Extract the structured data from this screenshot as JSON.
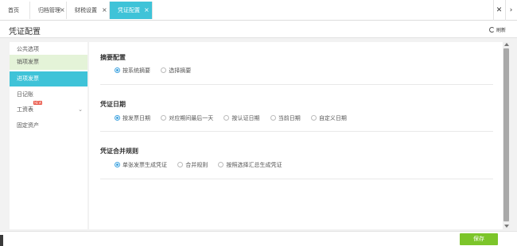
{
  "tabs": [
    {
      "label": "首页",
      "closable": false
    },
    {
      "label": "归档管理",
      "closable": true
    },
    {
      "label": "财税设置",
      "closable": true
    },
    {
      "label": "凭证配置",
      "closable": true,
      "active": true
    }
  ],
  "tabbar": {
    "close_glyph": "×",
    "close_all_glyph": "✕",
    "more_glyph": "›"
  },
  "header": {
    "title": "凭证配置",
    "refresh_label": "刷新"
  },
  "sidebar": {
    "items": [
      {
        "label": "公共选项"
      },
      {
        "label": "销项发票",
        "state": "light"
      },
      {
        "label": "进项发票",
        "state": "active"
      },
      {
        "label": "日记账"
      },
      {
        "label": "工资表",
        "badge": "NEW",
        "has_children": true
      },
      {
        "label": "固定资产"
      }
    ]
  },
  "sections": [
    {
      "title": "摘要配置",
      "options": [
        {
          "label": "按系统摘要",
          "checked": true
        },
        {
          "label": "选择摘要",
          "checked": false
        }
      ]
    },
    {
      "title": "凭证日期",
      "options": [
        {
          "label": "按发票日期",
          "checked": true
        },
        {
          "label": "对应期间最后一天",
          "checked": false
        },
        {
          "label": "按认证日期",
          "checked": false
        },
        {
          "label": "当前日期",
          "checked": false
        },
        {
          "label": "自定义日期",
          "checked": false
        }
      ]
    },
    {
      "title": "凭证合并规则",
      "options": [
        {
          "label": "单张发票生成凭证",
          "checked": true
        },
        {
          "label": "合并规则",
          "checked": false
        },
        {
          "label": "按照选择汇总生成凭证",
          "checked": false
        }
      ]
    }
  ],
  "footer": {
    "save_label": "保存"
  },
  "colors": {
    "accent": "#3fc3d8",
    "save": "#7cc52a",
    "radio": "#3fa3e0",
    "light_item": "#e4f3d8"
  }
}
